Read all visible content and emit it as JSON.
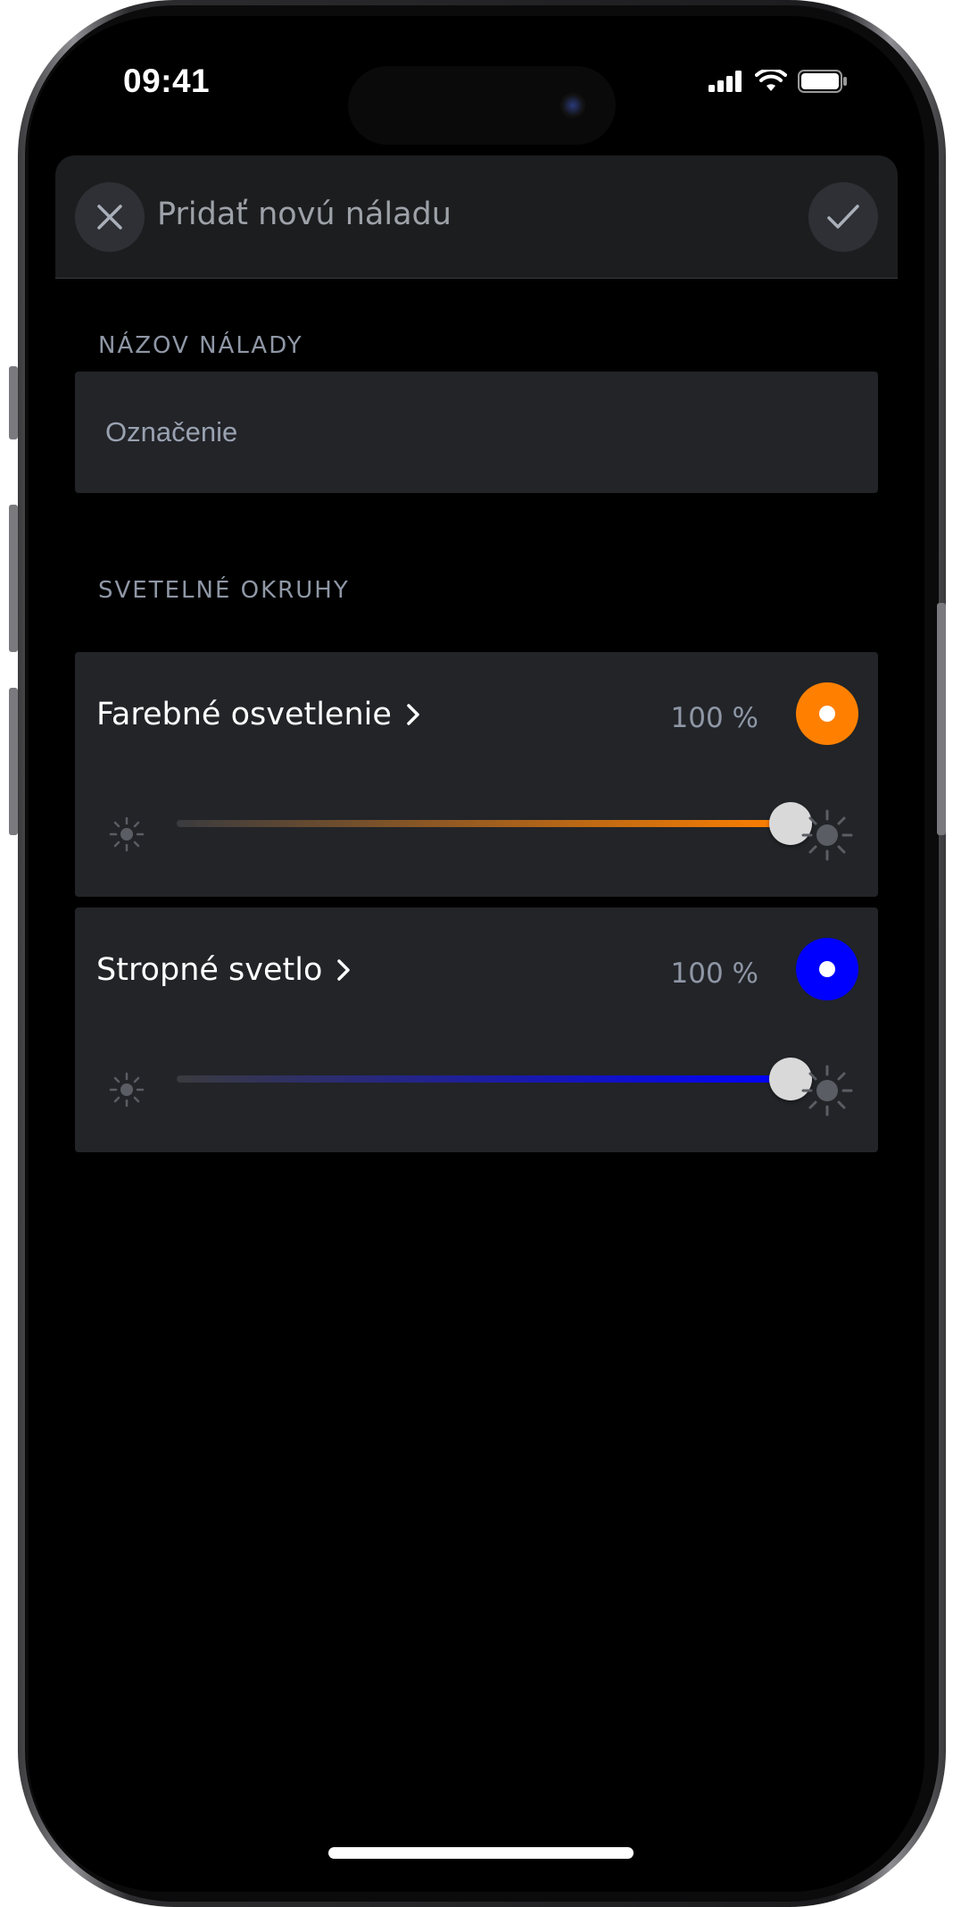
{
  "status_bar": {
    "time": "09:41"
  },
  "header": {
    "title": "Pridať novú náladu",
    "close_icon": "close-icon",
    "confirm_icon": "checkmark-icon"
  },
  "name_section": {
    "label": "NÁZOV NÁLADY",
    "placeholder": "Označenie",
    "value": ""
  },
  "circuits_section": {
    "label": "SVETELNÉ OKRUHY",
    "items": [
      {
        "name": "Farebné osvetlenie",
        "percent_label": "100 %",
        "level": 1.0,
        "color": "#ff8000",
        "track_start": "#3a3b3e",
        "track_end": "#ff8000"
      },
      {
        "name": "Stropné svetlo",
        "percent_label": "100 %",
        "level": 1.0,
        "color": "#0000ff",
        "track_start": "#3a3b3e",
        "track_end": "#0000ff"
      }
    ]
  },
  "colors": {
    "background": "#000000",
    "card": "#222428",
    "header": "#1c1d1f",
    "muted_text": "#8f97a6"
  }
}
